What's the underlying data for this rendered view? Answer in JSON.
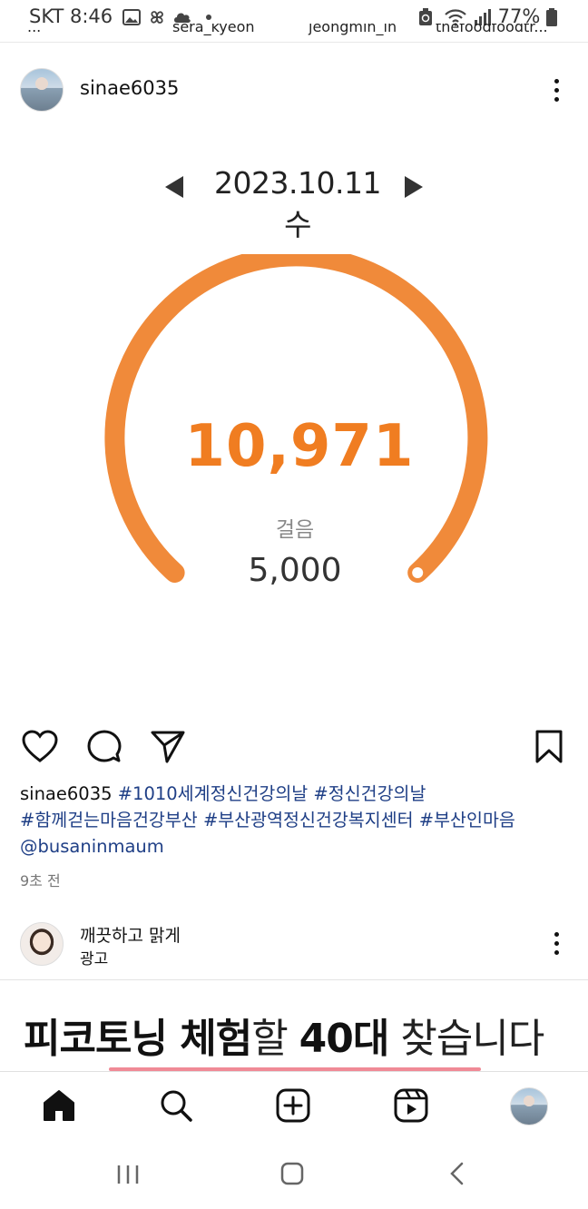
{
  "status_bar": {
    "carrier": "SKT",
    "time": "8:46",
    "battery": "77%"
  },
  "stories": [
    "...",
    "sera_kyeon",
    "jeongmin_in",
    "thefoodfoodtr..."
  ],
  "post": {
    "username": "sinae6035",
    "image": {
      "date": "2023.10.11 수",
      "steps": "10,971",
      "steps_label": "걸음",
      "goal": "5,000",
      "steps_progress": 1.0,
      "accent": "#f07d21"
    },
    "caption": {
      "username": "sinae6035",
      "line1_tags": [
        "#1010세계정신건강의날",
        "#정신건강의날"
      ],
      "line2_tags": [
        "#함께걷는마음건강부산",
        "#부산광역정신건강복지센터",
        "#부산인마음"
      ],
      "mention": "@busaninmaum"
    },
    "time_ago": "9초 전"
  },
  "ad": {
    "title": "깨끗하고 맑게",
    "label": "광고",
    "headline_part1": "피코토닝 체험",
    "headline_part2": "할 ",
    "headline_part3": "40대",
    "headline_part4": " 찾습니다",
    "accent": "#f08a96"
  },
  "icons": {
    "actions": [
      "heart-icon",
      "comment-icon",
      "share-icon",
      "bookmark-icon"
    ],
    "bottom_nav": [
      "home-icon",
      "search-icon",
      "create-icon",
      "reels-icon",
      "profile-avatar"
    ],
    "system_nav": [
      "recents-icon",
      "home-circle-icon",
      "back-icon"
    ]
  }
}
